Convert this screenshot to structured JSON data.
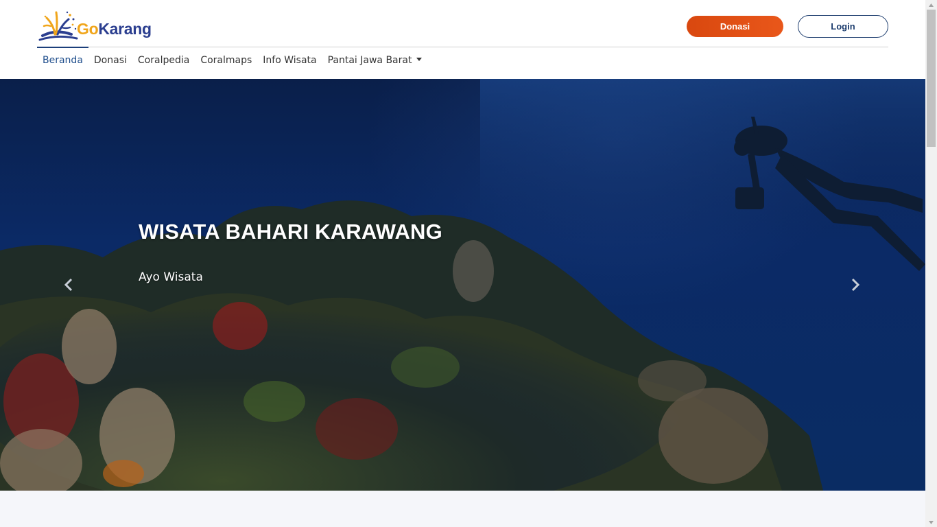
{
  "brand": {
    "prefix": "Go",
    "suffix": "Karang",
    "logo_icon": "coral-logo-icon"
  },
  "header": {
    "donate_label": "Donasi",
    "login_label": "Login"
  },
  "nav": {
    "items": [
      {
        "label": "Beranda",
        "active": true
      },
      {
        "label": "Donasi"
      },
      {
        "label": "Coralpedia"
      },
      {
        "label": "Coralmaps"
      },
      {
        "label": "Info Wisata"
      },
      {
        "label": "Pantai Jawa Barat",
        "dropdown": true
      }
    ]
  },
  "hero": {
    "title": "WISATA BAHARI KARAWANG",
    "subtitle": "Ayo Wisata",
    "prev_icon": "chevron-left-icon",
    "next_icon": "chevron-right-icon"
  },
  "colors": {
    "brand_navy": "#2b3e8f",
    "brand_orange": "#f0a51a",
    "donate_button": "#e1500f",
    "login_border": "#1d3d6e",
    "nav_active": "#1f4e8c"
  }
}
